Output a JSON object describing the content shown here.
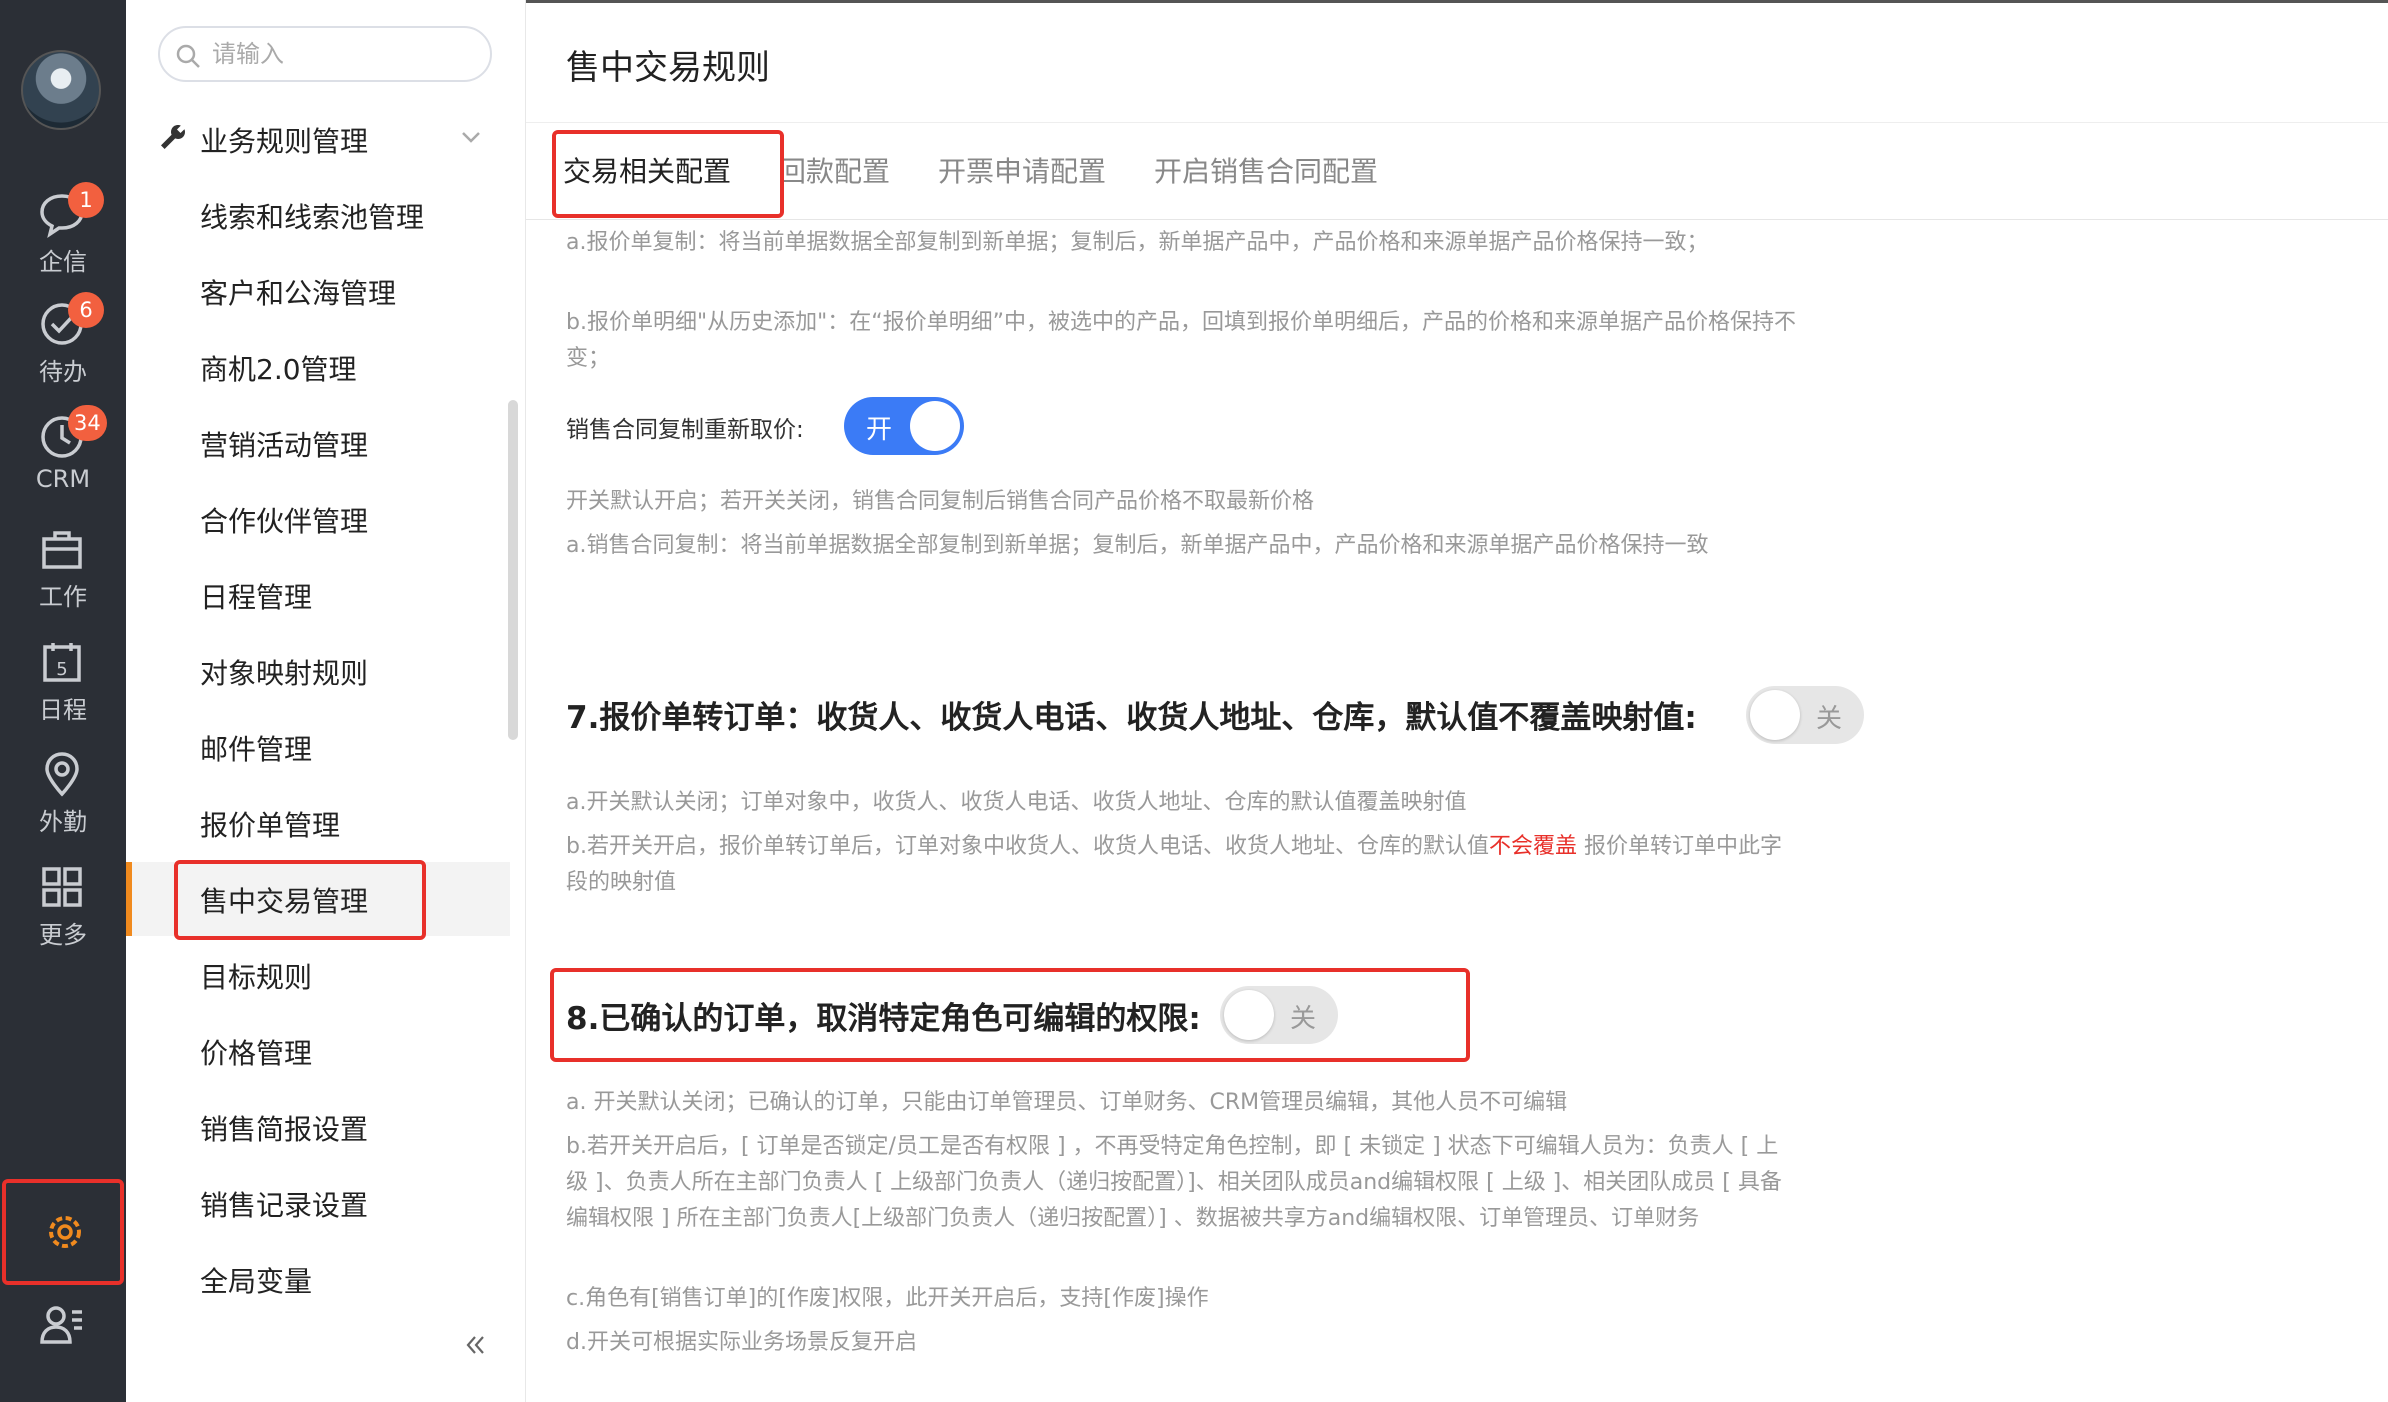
{
  "nav": {
    "items": [
      {
        "label": "企信",
        "icon": "chat-icon",
        "badge": "1"
      },
      {
        "label": "待办",
        "icon": "check-circle-icon",
        "badge": "6"
      },
      {
        "label": "CRM",
        "icon": "clock-icon",
        "badge": "34"
      },
      {
        "label": "工作",
        "icon": "briefcase-icon"
      },
      {
        "label": "日程",
        "icon": "calendar-icon",
        "day": "5"
      },
      {
        "label": "外勤",
        "icon": "location-pin-icon"
      },
      {
        "label": "更多",
        "icon": "grid-icon"
      }
    ],
    "settings_icon": "gear-icon",
    "profile_icon": "user-list-icon",
    "accent": "#f08a1e",
    "badge_color": "#f2603f"
  },
  "sidebar": {
    "search_placeholder": "请输入",
    "group_label": "业务规则管理",
    "items": [
      "线索和线索池管理",
      "客户和公海管理",
      "商机2.0管理",
      "营销活动管理",
      "合作伙伴管理",
      "日程管理",
      "对象映射规则",
      "邮件管理",
      "报价单管理",
      "售中交易管理",
      "目标规则",
      "价格管理",
      "销售简报设置",
      "销售记录设置",
      "全局变量"
    ],
    "active_item": "售中交易管理"
  },
  "main": {
    "title": "售中交易规则",
    "tabs": [
      "交易相关配置",
      "回款配置",
      "开票申请配置",
      "开启销售合同配置"
    ],
    "active_tab": "交易相关配置",
    "desc_a1": "a.报价单复制：将当前单据数据全部复制到新单据；复制后，新单据产品中，产品价格和来源单据产品价格保持一致；",
    "desc_b1": "b.报价单明细\"从历史添加\"：在“报价单明细”中，被选中的产品，回填到报价单明细后，产品的价格和来源单据产品价格保持不变；",
    "contract_label": "销售合同复制重新取价:",
    "contract_switch": "开",
    "contract_desc1": "开关默认开启；若开关关闭，销售合同复制后销售合同产品价格不取最新价格",
    "contract_desc2": "a.销售合同复制：将当前单据数据全部复制到新单据；复制后，新单据产品中，产品价格和来源单据产品价格保持一致",
    "h7": "7.报价单转订单：收货人、收货人电话、收货人地址、仓库，默认值不覆盖映射值:",
    "h7_switch": "关",
    "h7_desc_a": "a.开关默认关闭；订单对象中，收货人、收货人电话、收货人地址、仓库的默认值覆盖映射值",
    "h7_desc_b1": "b.若开关开启，报价单转订单后，订单对象中收货人、收货人电话、收货人地址、仓库的默认值",
    "h7_desc_b_red": "不会覆盖",
    "h7_desc_b2": " 报价单转订单中此字段的映射值",
    "h8": "8.已确认的订单，取消特定角色可编辑的权限:",
    "h8_switch": "关",
    "h8_desc_a": "a. 开关默认关闭；已确认的订单，只能由订单管理员、订单财务、CRM管理员编辑，其他人员不可编辑",
    "h8_desc_b": "b.若开关开启后，[ 订单是否锁定/员工是否有权限 ] ，不再受特定角色控制，即 [ 未锁定 ] 状态下可编辑人员为：负责人 [ 上级 ]、负责人所在主部门负责人 [ 上级部门负责人（递归按配置）]、相关团队成员and编辑权限 [ 上级 ]、相关团队成员 [ 具备编辑权限 ] 所在主部门负责人[上级部门负责人（递归按配置）] 、数据被共享方and编辑权限、订单管理员、订单财务",
    "h8_desc_c": "c.角色有[销售订单]的[作废]权限，此开关开启后，支持[作废]操作",
    "h8_desc_d": "d.开关可根据实际业务场景反复开启",
    "switch_on_color": "#3b7bf6",
    "highlight_color": "#e8302a"
  }
}
